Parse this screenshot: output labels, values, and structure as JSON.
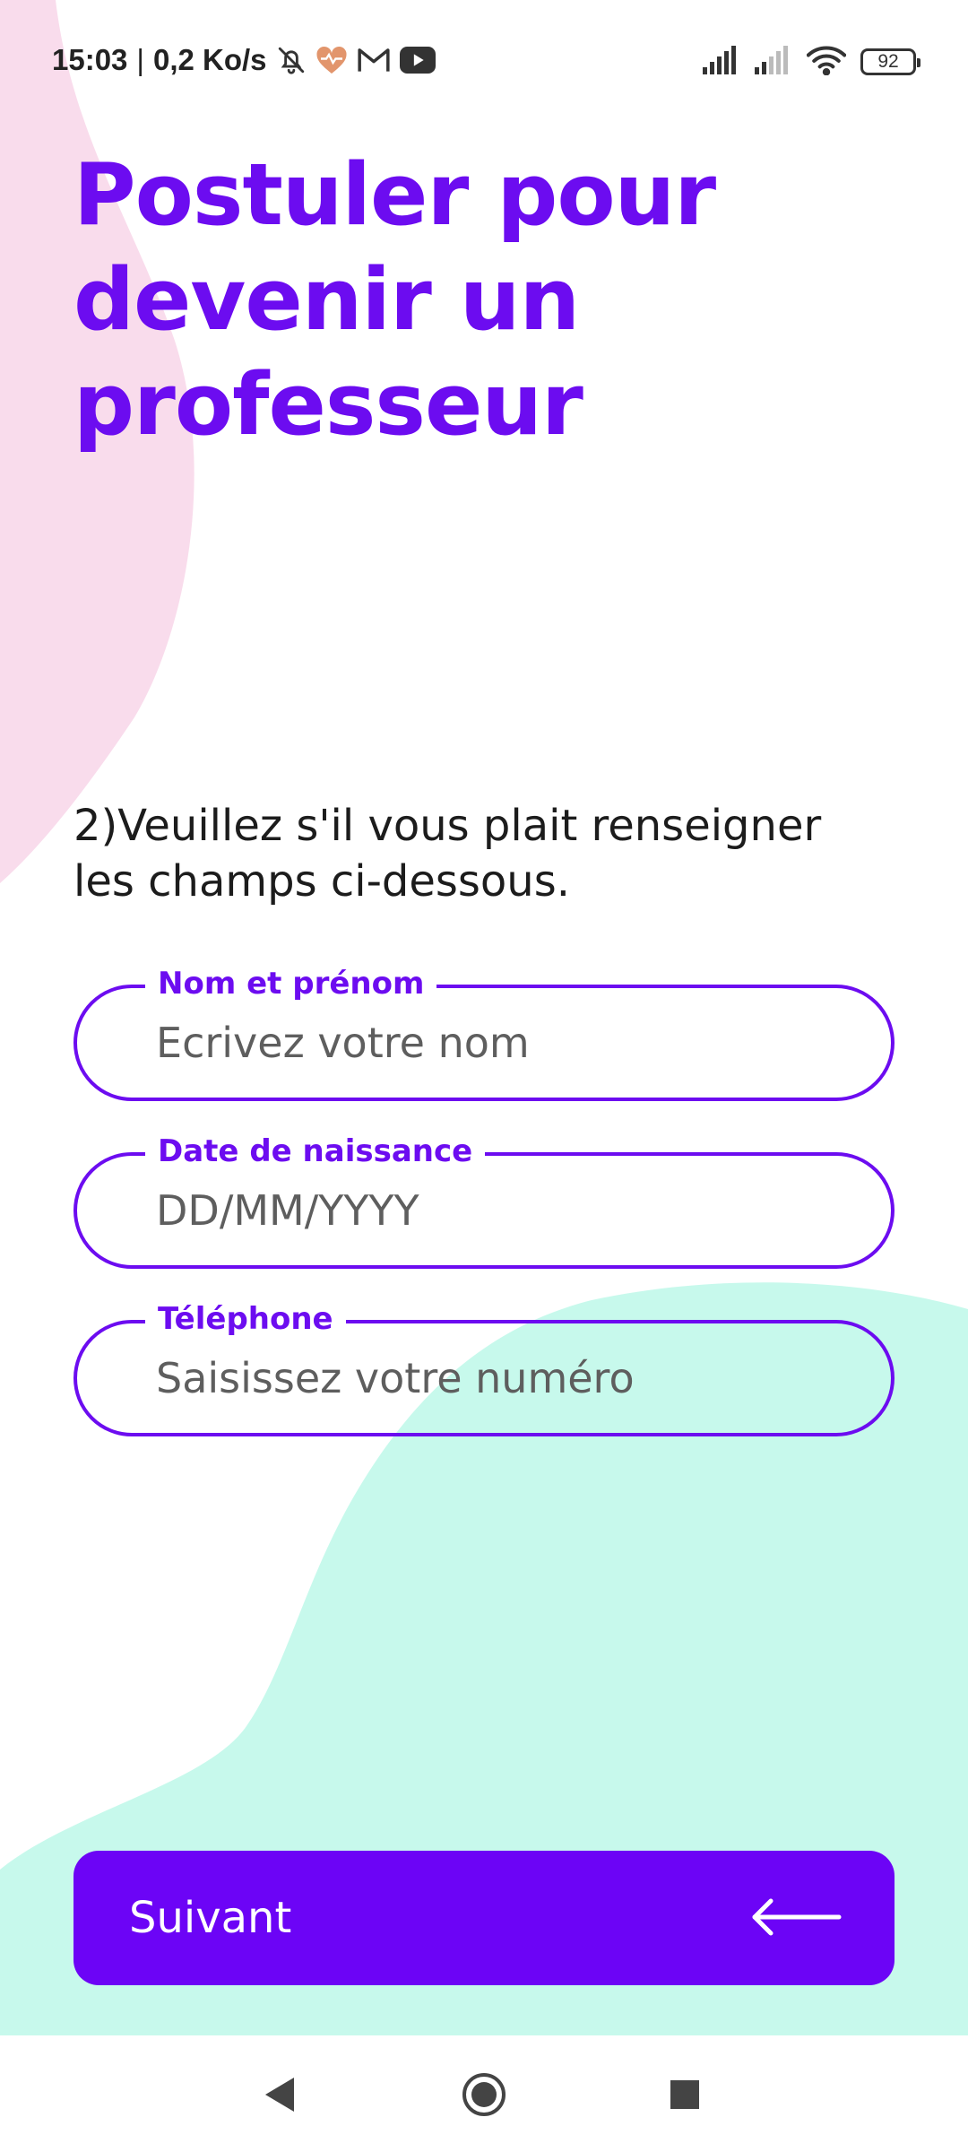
{
  "status_bar": {
    "time": "15:03",
    "separator": "|",
    "network_speed": "0,2 Ko/s",
    "battery_level": "92",
    "icons": [
      "bell-off-icon",
      "health-heart-icon",
      "gmail-icon",
      "youtube-icon",
      "signal-icon",
      "signal-weak-icon",
      "wifi-icon",
      "battery-icon"
    ]
  },
  "title_lines": [
    "Postuler pour",
    "devenir un",
    "professeur"
  ],
  "instruction_lines": [
    "2)Veuillez s'il vous plait renseigner",
    "les champs ci-dessous."
  ],
  "form": {
    "fields": [
      {
        "label": "Nom et prénom",
        "placeholder": "Ecrivez votre nom",
        "value": ""
      },
      {
        "label": "Date de naissance",
        "placeholder": "DD/MM/YYYY",
        "value": ""
      },
      {
        "label": "Téléphone",
        "placeholder": "Saisissez votre numéro",
        "value": ""
      }
    ]
  },
  "next_button": {
    "label": "Suivant",
    "icon": "arrow-left-icon"
  },
  "nav_bar": {
    "icons": [
      "back-icon",
      "home-icon",
      "recents-icon"
    ]
  },
  "colors": {
    "accent": "#6c0cf0",
    "button": "#6c04f6",
    "blob_pink": "#f9dcec",
    "blob_mint": "#c7f9ec"
  }
}
